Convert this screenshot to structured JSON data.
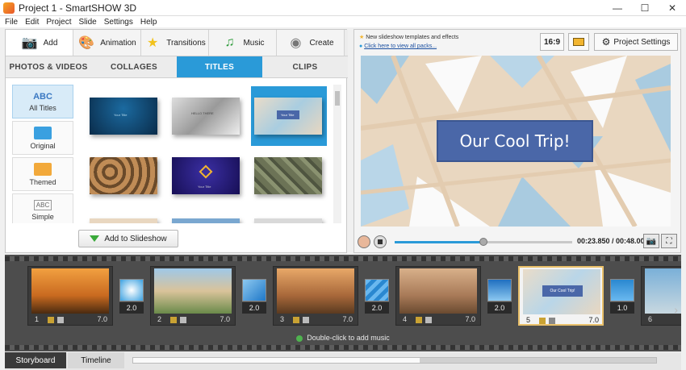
{
  "window": {
    "title": "Project 1 - SmartSHOW 3D"
  },
  "menu": [
    "File",
    "Edit",
    "Project",
    "Slide",
    "Settings",
    "Help"
  ],
  "top_tabs": [
    {
      "label": "Add",
      "icon": "add-photo-icon"
    },
    {
      "label": "Animation",
      "icon": "palette-icon"
    },
    {
      "label": "Transitions",
      "icon": "star-icon"
    },
    {
      "label": "Music",
      "icon": "music-note-icon"
    },
    {
      "label": "Create",
      "icon": "film-reel-icon"
    }
  ],
  "sub_tabs": [
    "PHOTOS & VIDEOS",
    "COLLAGES",
    "TITLES",
    "CLIPS"
  ],
  "active_sub_tab": "TITLES",
  "categories": [
    {
      "label": "All Titles",
      "badge": "ABC"
    },
    {
      "label": "Original"
    },
    {
      "label": "Themed"
    },
    {
      "label": "Simple",
      "badge": "ABC"
    }
  ],
  "thumbnails": [
    {
      "caption": "Your Title"
    },
    {
      "caption": "HELLO THERE"
    },
    {
      "caption": "Your Title"
    },
    {
      "caption": ""
    },
    {
      "caption": "Your Title"
    },
    {
      "caption": ""
    }
  ],
  "add_button": "Add to Slideshow",
  "promo": {
    "line1": "New slideshow templates and effects",
    "line2": "Click here to view all packs..."
  },
  "toolbar": {
    "ratio": "16:9",
    "settings": "Project Settings"
  },
  "preview": {
    "title_text": "Our Cool Trip!"
  },
  "player": {
    "time": "00:23.850 / 00:48.000",
    "progress": 0.5
  },
  "slides": [
    {
      "num": "1",
      "duration": "7.0"
    },
    {
      "num": "2",
      "duration": "7.0"
    },
    {
      "num": "3",
      "duration": "7.0"
    },
    {
      "num": "4",
      "duration": "7.0"
    },
    {
      "num": "5",
      "duration": "7.0",
      "title": "Our Cool Trip!"
    },
    {
      "num": "6",
      "duration": ""
    }
  ],
  "transitions": [
    "2.0",
    "2.0",
    "2.0",
    "2.0",
    "1.0"
  ],
  "music_hint": "Double-click to add music",
  "bottom_tabs": [
    "Storyboard",
    "Timeline"
  ],
  "colors": {
    "accent": "#2a9ad8",
    "title_box": "#4a67a8",
    "selected_slide_border": "#e9c06a"
  }
}
